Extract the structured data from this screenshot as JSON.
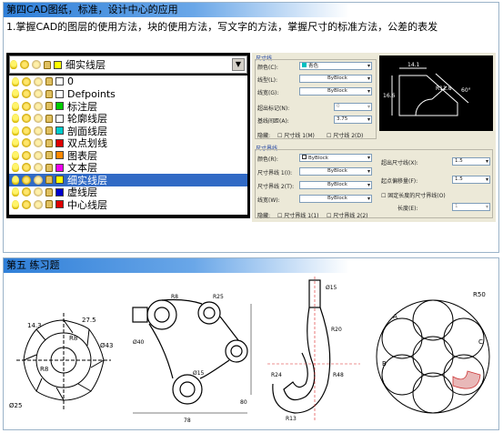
{
  "section1": {
    "heading": "第四CAD图纸，标准，设计中心的应用",
    "subtitle": "1.掌握CAD的图层的使用方法，块的使用方法，写文字的方法，掌握尺寸的标准方法，公差的表发"
  },
  "layer_panel": {
    "current_layer": "细实线层",
    "layers": [
      {
        "name": "0",
        "color": "#ffffff"
      },
      {
        "name": "Defpoints",
        "color": "#ffffff"
      },
      {
        "name": "标注层",
        "color": "#00cc00"
      },
      {
        "name": "轮廓线层",
        "color": "#ffffff"
      },
      {
        "name": "剖面线层",
        "color": "#00cccc"
      },
      {
        "name": "双点划线",
        "color": "#dd0000"
      },
      {
        "name": "图表层",
        "color": "#ff8800"
      },
      {
        "name": "文本层",
        "color": "#ee00ee"
      },
      {
        "name": "细实线层",
        "color": "#ffff00",
        "selected": true
      },
      {
        "name": "虚线层",
        "color": "#0000cc"
      },
      {
        "name": "中心线层",
        "color": "#dd0000"
      }
    ]
  },
  "dim_dialog": {
    "group1_title": "尺寸线",
    "color_label": "颜色(C):",
    "color_value": "青色",
    "linetype_label": "线型(L):",
    "linetype_value": "ByBlock",
    "lineweight_label": "线宽(G):",
    "lineweight_value": "ByBlock",
    "extend_label": "超出标记(N):",
    "extend_value": "0",
    "baseline_label": "基线间距(A):",
    "baseline_value": "3.75",
    "hide_label": "隐藏:",
    "hide_opt1": "尺寸线 1(M)",
    "hide_opt2": "尺寸线 2(D)",
    "group2_title": "尺寸界线",
    "ext_color_label": "颜色(R):",
    "ext_color_value": "ByBlock",
    "ext_lt1_label": "尺寸界线 1(I):",
    "ext_lt1_value": "ByBlock",
    "ext_lt2_label": "尺寸界线 2(T):",
    "ext_lt2_value": "ByBlock",
    "ext_lw_label": "线宽(W):",
    "ext_lw_value": "ByBlock",
    "beyond_label": "超出尺寸线(X):",
    "beyond_value": "1.5",
    "offset_label": "起点偏移量(F):",
    "offset_value": "1.5",
    "fixed_len_label": "固定长度的尺寸界线(O)",
    "length_label": "长度(E):",
    "length_value": "1",
    "ext_hide_label": "隐藏:",
    "ext_hide_opt1": "尺寸界线 1(1)",
    "ext_hide_opt2": "尺寸界线 2(2)",
    "preview_dims": [
      "14.1",
      "16.6",
      "R11.8",
      "60°"
    ]
  },
  "section2": {
    "heading": "第五  练习题"
  },
  "exercises": {
    "ex1_labels": [
      "Ø43",
      "Ø25",
      "R8",
      "R8",
      "14.3",
      "27.5"
    ],
    "ex2_labels": [
      "R8",
      "R25",
      "Ø40",
      "Ø15",
      "78",
      "80"
    ],
    "ex3_labels": [
      "Ø15",
      "R20",
      "R48",
      "R24",
      "R13"
    ],
    "ex4_labels": [
      "R50",
      "A",
      "B",
      "C"
    ]
  }
}
